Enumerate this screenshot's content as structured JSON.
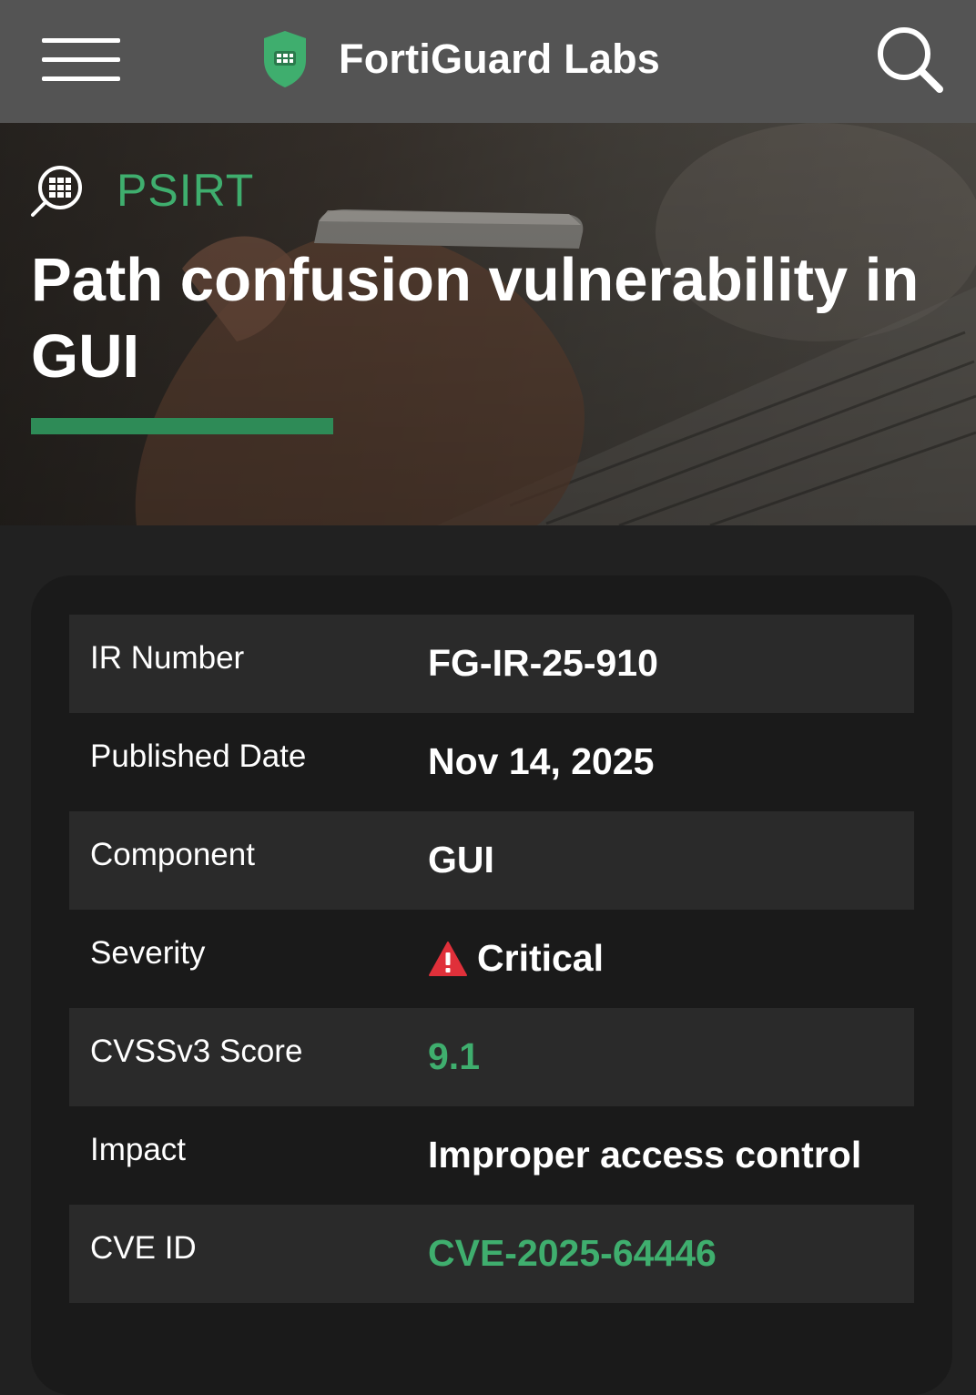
{
  "header": {
    "brand": "FortiGuard Labs",
    "icons": {
      "menu": "hamburger-menu-icon",
      "logo": "shield-logo-icon",
      "search": "search-icon"
    },
    "background_color": "#545454"
  },
  "hero": {
    "section_label": "PSIRT",
    "section_icon": "globe-search-icon",
    "title": "Path confusion vulnerability in GUI",
    "accent_color": "#2e8b57",
    "label_color": "#3fae6e"
  },
  "details": {
    "rows": [
      {
        "label": "IR Number",
        "value": "FG-IR-25-910"
      },
      {
        "label": "Published Date",
        "value": "Nov 14, 2025"
      },
      {
        "label": "Component",
        "value": "GUI"
      },
      {
        "label": "Severity",
        "value": "Critical",
        "icon": "warning-triangle-icon",
        "icon_color": "#e0303a"
      },
      {
        "label": "CVSSv3 Score",
        "value": "9.1",
        "value_color": "#3fae6e"
      },
      {
        "label": "Impact",
        "value": "Improper access control"
      },
      {
        "label": "CVE ID",
        "value": "CVE-2025-64446",
        "value_color": "#3fae6e"
      }
    ]
  }
}
